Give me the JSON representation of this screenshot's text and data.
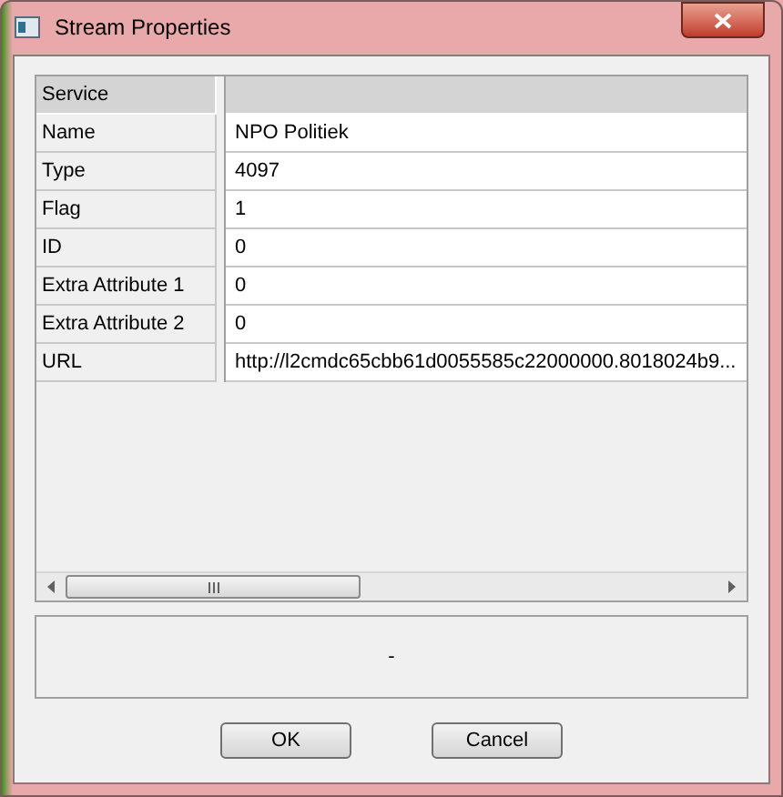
{
  "window": {
    "title": "Stream Properties"
  },
  "table": {
    "header": "Service",
    "rows": [
      {
        "label": "Name",
        "value": "NPO Politiek"
      },
      {
        "label": "Type",
        "value": "4097"
      },
      {
        "label": "Flag",
        "value": "1"
      },
      {
        "label": "ID",
        "value": "0"
      },
      {
        "label": "Extra Attribute 1",
        "value": "0"
      },
      {
        "label": "Extra Attribute 2",
        "value": "0"
      },
      {
        "label": "URL",
        "value": "http://l2cmdc65cbb61d0055585c22000000.8018024b9..."
      }
    ]
  },
  "status_text": "-",
  "buttons": [
    "OK",
    "Cancel"
  ]
}
